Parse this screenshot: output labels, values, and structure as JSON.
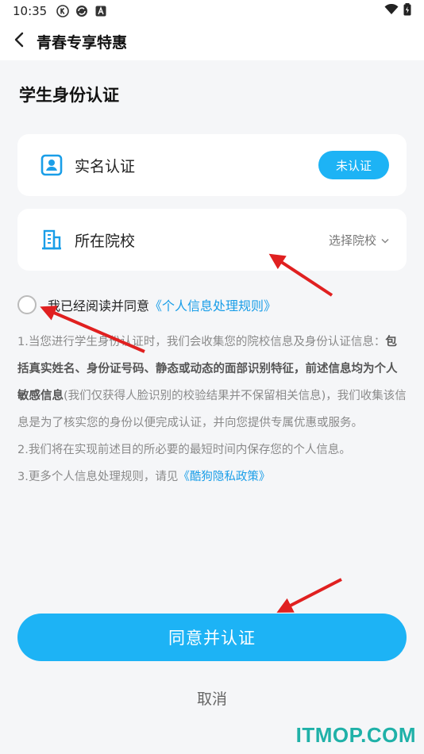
{
  "status_bar": {
    "time": "10:35",
    "icons": [
      "k-circle-icon",
      "sync-icon",
      "a-box-icon",
      "wifi-icon",
      "battery-charging-icon"
    ]
  },
  "header": {
    "title": "青春专享特惠",
    "back_icon": "chevron-left-icon"
  },
  "page": {
    "section_title": "学生身份认证",
    "real_name_card": {
      "label": "实名认证",
      "icon": "id-card-icon",
      "status": "未认证"
    },
    "school_card": {
      "label": "所在院校",
      "icon": "building-icon",
      "select_label": "选择院校"
    },
    "agreement": {
      "prefix": "我已经阅读并同意",
      "link": "《个人信息处理规则》"
    },
    "notes": {
      "p1_a": "1.当您进行学生身份认证时，我们会收集您的院校信息及身份认证信息：",
      "p1_bold": "包括真实姓名、身份证号码、静态或动态的面部识别特征，前述信息均为个人敏感信息",
      "p1_b": "(我们仅获得人脸识别的校验结果并不保留相关信息)，我们收集该信息是为了核实您的身份以便完成认证，并向您提供专属优惠或服务。",
      "p2": "2.我们将在实现前述目的所必要的最短时间内保存您的个人信息。",
      "p3_a": "3.更多个人信息处理规则，请见",
      "p3_link": "《酷狗隐私政策》"
    },
    "primary_button": "同意并认证",
    "cancel_button": "取消"
  },
  "watermark": "ITMOP.COM",
  "colors": {
    "accent": "#1db3f5",
    "link": "#1a9ee8",
    "arrow": "#e02020",
    "watermark": "#1fb1a8"
  }
}
